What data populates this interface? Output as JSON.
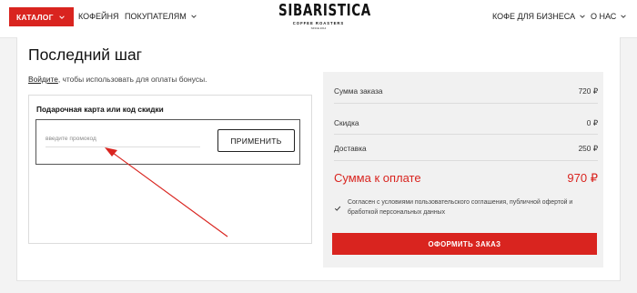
{
  "header": {
    "catalog_label": "КАТАЛОГ",
    "coffeeshops_label": "КОФЕЙНЯ",
    "buyers_label": "ПОКУПАТЕЛЯМ",
    "business_label": "КОФЕ ДЛЯ БИЗНЕСА",
    "about_label": "О НАС",
    "logo": {
      "name": "SIBARISTICA",
      "tagline": "COFFEE ROASTERS",
      "est": "SINCE 2014"
    }
  },
  "page": {
    "title": "Последний шаг",
    "login_link": "Войдите",
    "login_rest": ", чтобы использовать для оплаты бонусы."
  },
  "promo": {
    "title": "Подарочная карта или код скидки",
    "placeholder": "введите промокод",
    "apply_label": "ПРИМЕНИТЬ"
  },
  "summary": {
    "order_sum_label": "Сумма заказа",
    "order_sum_value": "720 ₽",
    "discount_label": "Скидка",
    "discount_value": "0 ₽",
    "delivery_label": "Доставка",
    "delivery_value": "250 ₽",
    "total_label": "Сумма к оплате",
    "total_value": "970 ₽",
    "agreement_text": "Согласен с условиями пользовательского соглашения, публичной офертой и бработкой персональных данных",
    "agreement_checked": true,
    "submit_label": "ОФОРМИТЬ ЗАКАЗ"
  },
  "colors": {
    "accent": "#d9241f",
    "panel": "#f1f1f1"
  },
  "icons": {
    "dropdown": "chevron-down-icon",
    "agreement": "checkmark-icon",
    "annotation": "arrow-annotation"
  }
}
